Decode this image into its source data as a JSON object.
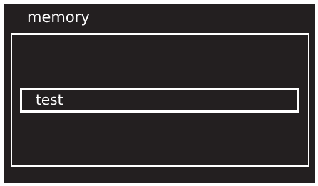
{
  "screen": {
    "title": "memory",
    "background_color": "#231f20",
    "foreground_color": "#ffffff"
  },
  "list": {
    "items": [
      {
        "label": "test",
        "selected": true
      }
    ]
  }
}
